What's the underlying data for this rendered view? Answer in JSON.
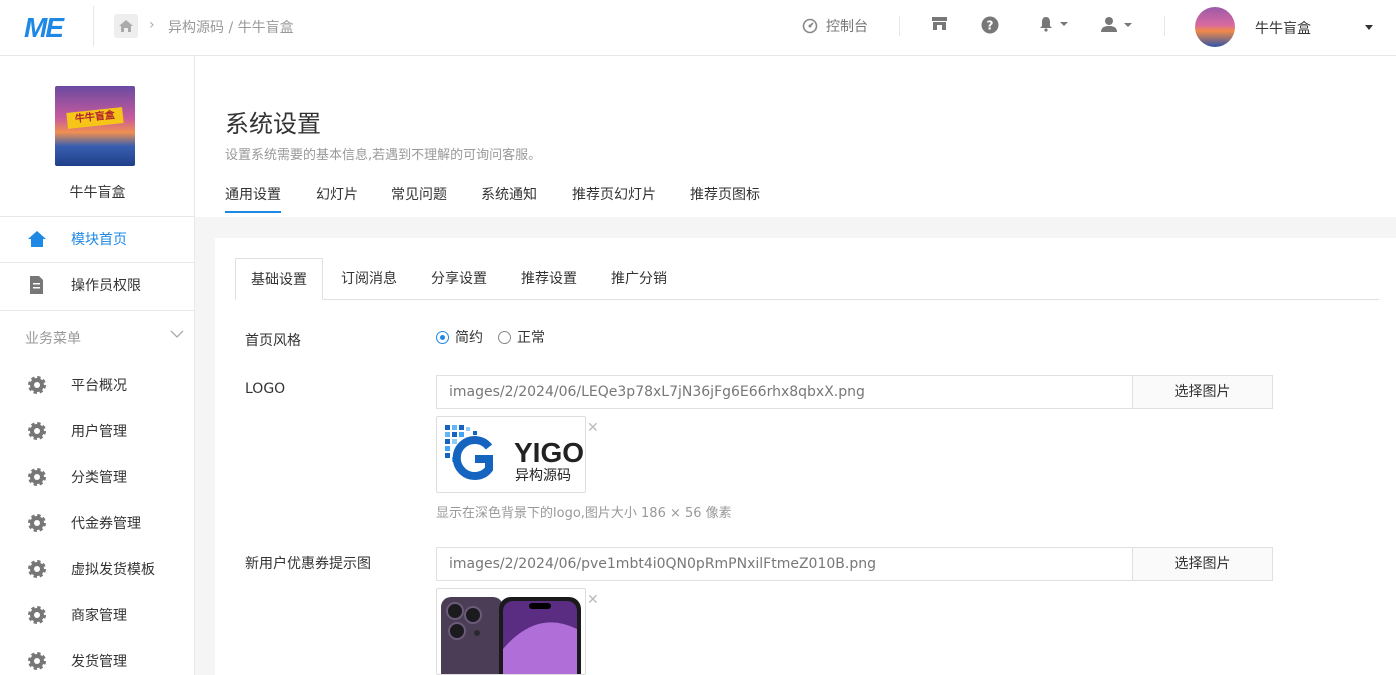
{
  "topbar": {
    "logo": "ME",
    "breadcrumb": "异构源码 / 牛牛盲盒",
    "console": "控制台",
    "user_name": "牛牛盲盒"
  },
  "sidebar": {
    "shop_name": "牛牛盲盒",
    "logo_banner": "牛牛盲盒",
    "top_items": [
      {
        "label": "模块首页",
        "active": true
      },
      {
        "label": "操作员权限"
      }
    ],
    "group_title": "业务菜单",
    "menu": [
      "平台概况",
      "用户管理",
      "分类管理",
      "代金券管理",
      "虚拟发货模板",
      "商家管理",
      "发货管理"
    ]
  },
  "main": {
    "title": "系统设置",
    "description": "设置系统需要的基本信息,若遇到不理解的可询问客服。",
    "tabs": [
      "通用设置",
      "幻灯片",
      "常见问题",
      "系统通知",
      "推荐页幻灯片",
      "推荐页图标"
    ],
    "sub_tabs": [
      "基础设置",
      "订阅消息",
      "分享设置",
      "推荐设置",
      "推广分销"
    ]
  },
  "form": {
    "style_label": "首页风格",
    "style_options": [
      "简约",
      "正常"
    ],
    "style_selected": "简约",
    "logo_label": "LOGO",
    "logo_path": "images/2/2024/06/LEQe3p78xL7jN36jFg6E66rhx8qbxX.png",
    "logo_brand": "YIGO",
    "logo_brand_sub": "异构源码",
    "logo_hint": "显示在深色背景下的logo,图片大小 186 × 56 像素",
    "coupon_label": "新用户优惠券提示图",
    "coupon_path": "images/2/2024/06/pve1mbt4i0QN0pRmPNxilFtmeZ010B.png",
    "choose_btn": "选择图片"
  },
  "colors": {
    "accent": "#1e88e5",
    "text": "#333333",
    "muted": "#999999"
  }
}
